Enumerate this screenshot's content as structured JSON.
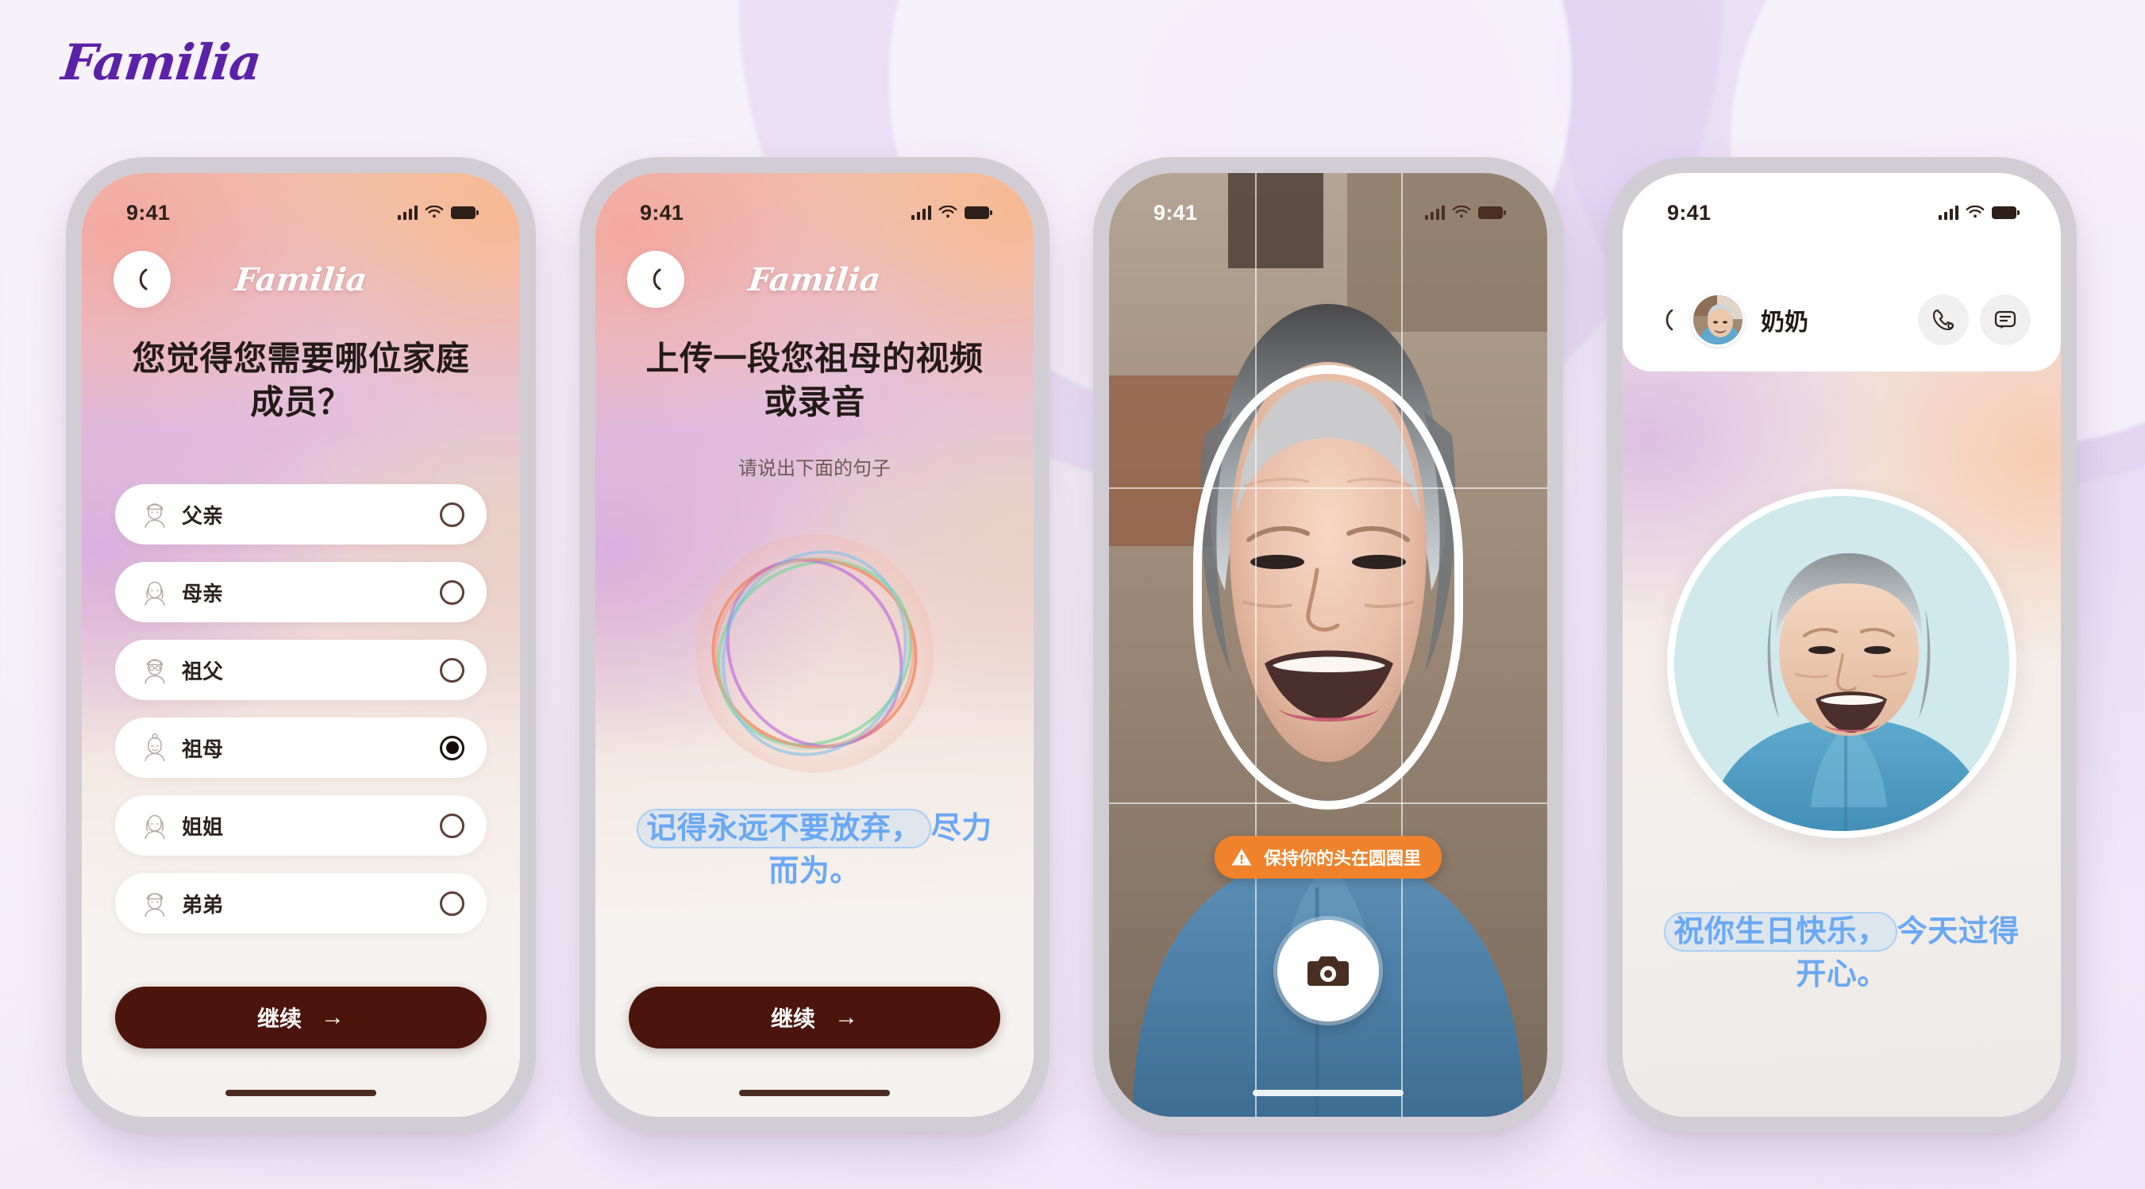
{
  "brand": {
    "name": "Familia",
    "accent_color": "#5b21a8"
  },
  "status_bar": {
    "time": "9:41",
    "cellular_icon": "cellular-bars-icon",
    "wifi_icon": "wifi-icon",
    "battery_icon": "battery-icon"
  },
  "screen1": {
    "header_logo": "Familia",
    "back_icon": "chevron-left-icon",
    "title": "您觉得您需要哪位家庭成员？",
    "options": [
      {
        "label": "父亲",
        "icon": "father-avatar-icon",
        "selected": false
      },
      {
        "label": "母亲",
        "icon": "mother-avatar-icon",
        "selected": false
      },
      {
        "label": "祖父",
        "icon": "grandfather-avatar-icon",
        "selected": false
      },
      {
        "label": "祖母",
        "icon": "grandmother-avatar-icon",
        "selected": true
      },
      {
        "label": "姐姐",
        "icon": "sister-avatar-icon",
        "selected": false
      },
      {
        "label": "弟弟",
        "icon": "brother-avatar-icon",
        "selected": false
      }
    ],
    "cta_label": "继续",
    "cta_arrow": "→",
    "cta_color": "#4c150c"
  },
  "screen2": {
    "header_logo": "Familia",
    "back_icon": "chevron-left-icon",
    "title": "上传一段您祖母的视频或录音",
    "subtitle": "请说出下面的句子",
    "visualizer_icon": "audio-orb-visualizer",
    "quote_highlight": "记得永远不要放弃，",
    "quote_rest": "尽力而为。",
    "quote_color": "#6aa8f5",
    "cta_label": "继续",
    "cta_arrow": "→",
    "cta_color": "#4c150c"
  },
  "screen3": {
    "camera_subject": "elderly-woman-portrait",
    "face_guide_icon": "face-oval-guide",
    "grid_icon": "rule-of-thirds-grid",
    "toast_text": "保持你的头在圆圈里",
    "toast_icon": "warning-triangle-icon",
    "toast_color": "#f0822b",
    "shutter_icon": "camera-icon"
  },
  "screen4": {
    "back_icon": "chevron-left-icon",
    "contact_name": "奶奶",
    "avatar_icon": "grandma-avatar",
    "call_icon": "phone-call-icon",
    "message_icon": "chat-bubble-icon",
    "portrait_icon": "grandma-portrait",
    "caption_highlight": "祝你生日快乐，",
    "caption_rest": "今天过得开心。",
    "caption_color": "#6aa8f5"
  }
}
